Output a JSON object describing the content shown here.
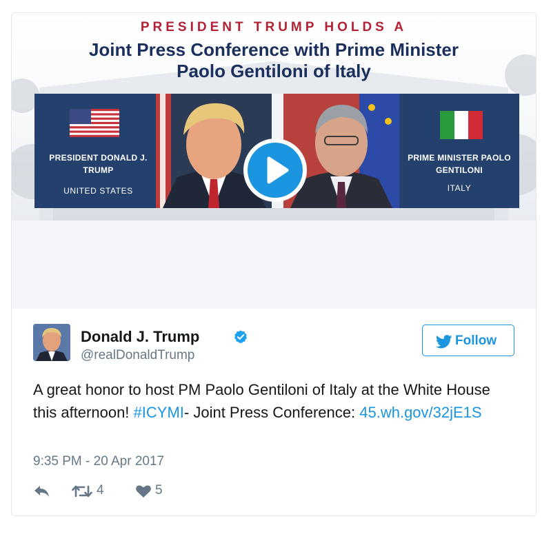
{
  "banner": {
    "kicker": "PRESIDENT TRUMP HOLDS A",
    "headline_line1": "Joint Press Conference with Prime Minister",
    "headline_line2": "Paolo Gentiloni of Italy",
    "left_panel": {
      "name_line1": "PRESIDENT DONALD J.",
      "name_line2": "TRUMP",
      "country": "UNITED STATES"
    },
    "right_panel": {
      "name_line1": "PRIME MINISTER PAOLO",
      "name_line2": "GENTILONI",
      "country": "ITALY"
    }
  },
  "author": {
    "display_name": "Donald J. Trump",
    "handle": "@realDonaldTrump",
    "verified": true
  },
  "follow_button": {
    "label": "Follow"
  },
  "tweet": {
    "text_part1": "A great honor to host PM Paolo Gentiloni of Italy at the White House this afternoon! ",
    "hashtag": "#ICYMI",
    "text_part2": "- Joint Press Conference: ",
    "link": "45.wh.gov/32jE1S",
    "timestamp": "9:35 PM - 20 Apr 2017"
  },
  "actions": {
    "reply_icon": "reply-icon",
    "retweet_icon": "retweet-icon",
    "like_icon": "heart-icon",
    "retweet_count": "4",
    "like_count": "5"
  },
  "colors": {
    "accent": "#1b95e0",
    "banner_navy": "#24406d",
    "kicker_red": "#b32134",
    "muted": "#657786"
  }
}
